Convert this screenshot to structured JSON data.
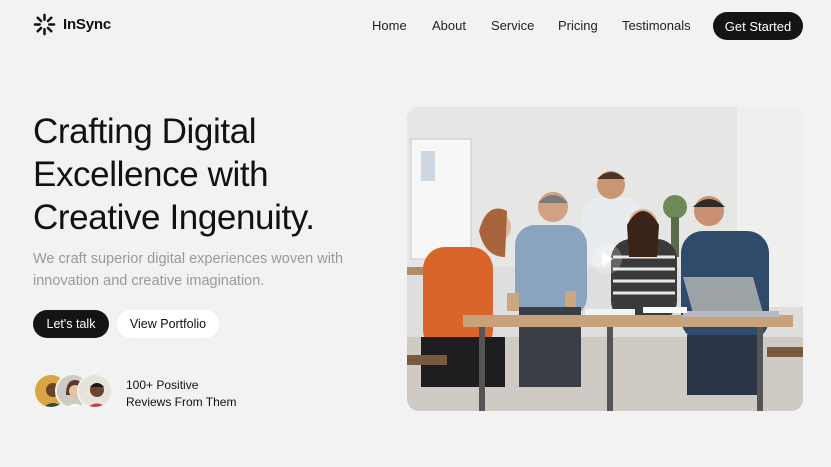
{
  "brand": {
    "name": "InSync"
  },
  "nav": {
    "links": [
      {
        "label": "Home"
      },
      {
        "label": "About"
      },
      {
        "label": "Service"
      },
      {
        "label": "Pricing"
      },
      {
        "label": "Testimonals"
      }
    ],
    "cta_label": "Get Started"
  },
  "hero": {
    "title_lines": [
      "Crafting Digital",
      "Excellence with",
      "Creative Ingenuity."
    ],
    "subtitle": "We craft superior digital experiences woven with innovation and creative imagination.",
    "primary_button": "Let's talk",
    "secondary_button": "View Portfolio"
  },
  "reviews": {
    "line1": "100+ Positive",
    "line2": "Reviews From Them",
    "avatar_icons": [
      "person-avatar-1",
      "person-avatar-2",
      "person-avatar-3"
    ]
  },
  "media": {
    "image_icon": "team-meeting-photo",
    "play_icon": "play-icon"
  },
  "colors": {
    "background": "#f2f2f2",
    "dark": "#141414",
    "muted_text": "#9a9a9a",
    "white": "#ffffff"
  }
}
